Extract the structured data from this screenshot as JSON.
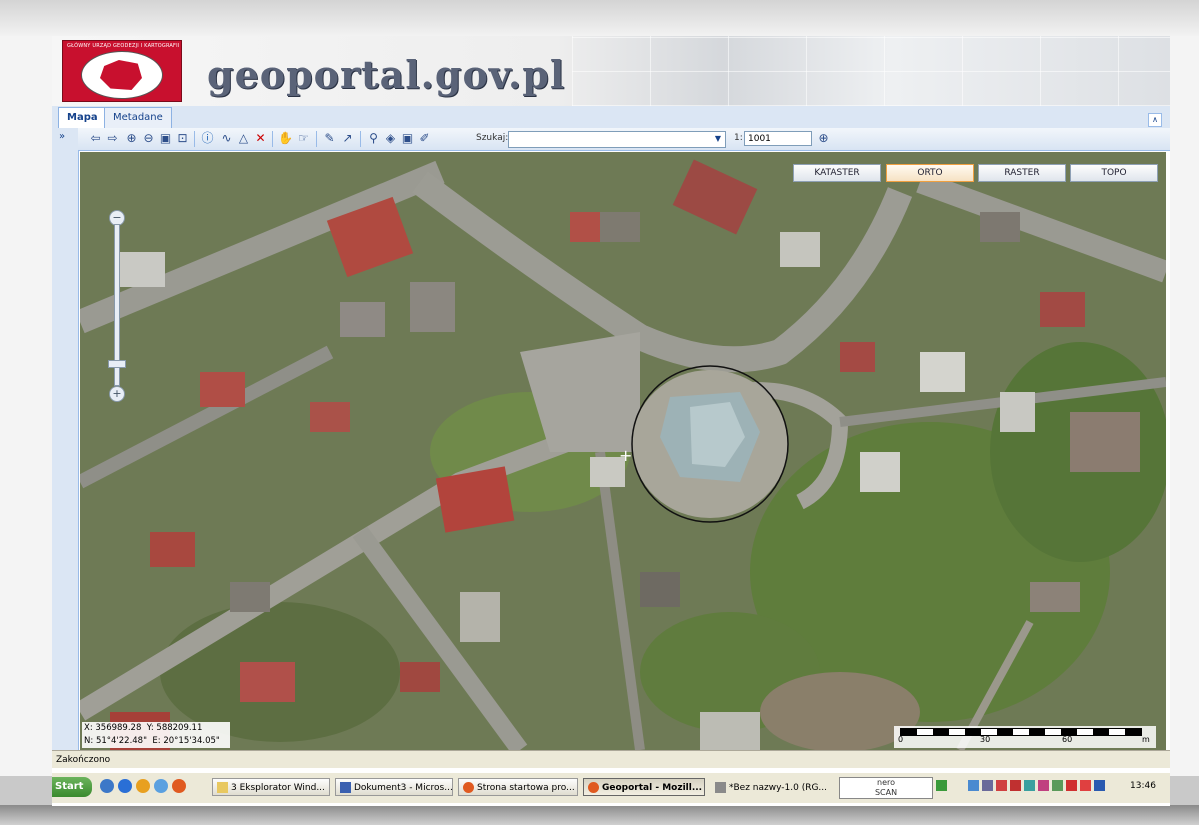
{
  "header": {
    "logo_text": "GŁÓWNY URZĄD GEODEZJI I KARTOGRAFII",
    "site_title": "geoportal.gov.pl"
  },
  "tabs": [
    {
      "label": "Mapa",
      "active": true
    },
    {
      "label": "Metadane",
      "active": false
    }
  ],
  "toolbar": {
    "icons": [
      "back-arrow-icon",
      "forward-arrow-icon",
      "zoom-in-icon",
      "zoom-out-icon",
      "zoom-box-icon",
      "zoom-extent-icon",
      "info-icon",
      "measure-line-icon",
      "measure-area-icon",
      "clear-measure-icon",
      "pan-hand-icon",
      "select-icon",
      "edit-icon",
      "export-icon",
      "search-icon",
      "layers-icon",
      "save-icon",
      "draw-icon"
    ],
    "search_label": "Szukaj:",
    "search_value": "",
    "scale_prefix": "1:",
    "scale_value": "1001"
  },
  "map": {
    "layer_buttons": [
      {
        "label": "KATASTER",
        "active": false
      },
      {
        "label": "ORTO",
        "active": true
      },
      {
        "label": "RASTER",
        "active": false
      },
      {
        "label": "TOPO",
        "active": false
      }
    ],
    "coords": {
      "x_label": "X:",
      "x_value": "356989.28",
      "y_label": "Y:",
      "y_value": "588209.11",
      "n_label": "N:",
      "n_value": "51°4'22.48\"",
      "e_label": "E:",
      "e_value": "20°15'34.05\""
    },
    "scalebar": {
      "labels": [
        "0",
        "30",
        "60"
      ],
      "unit": "m"
    },
    "zoom_level": 0.83
  },
  "status": {
    "text": "Zakończono"
  },
  "taskbar": {
    "start_label": "Start",
    "tasks": [
      {
        "label": "3 Eksplorator Wind...",
        "active": false,
        "icon": "folder-icon"
      },
      {
        "label": "Dokument3 - Micros...",
        "active": false,
        "icon": "word-icon"
      },
      {
        "label": "Strona startowa pro...",
        "active": false,
        "icon": "firefox-icon"
      },
      {
        "label": "Geoportal - Mozill...",
        "active": true,
        "icon": "firefox-icon"
      },
      {
        "label": "*Bez nazwy-1.0 (RG...",
        "active": false,
        "icon": "paint-icon"
      }
    ],
    "nero_label_1": "nero",
    "nero_label_2": "SCAN",
    "clock": "13:46"
  },
  "colors": {
    "accent": "#15428b",
    "logo_red": "#c8102e",
    "active_layer_border": "#f0a040"
  }
}
